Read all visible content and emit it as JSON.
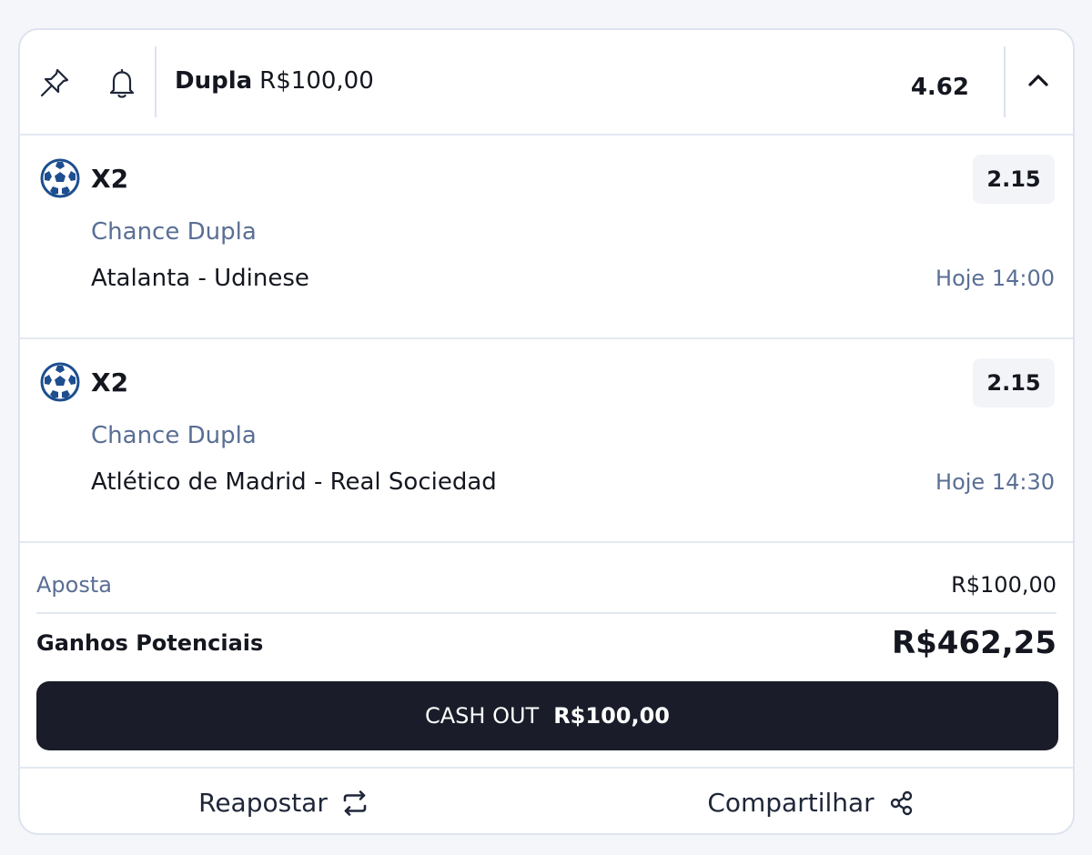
{
  "header": {
    "bet_type": "Dupla",
    "stake": "R$100,00",
    "total_odds": "4.62",
    "pin_icon": "pin-icon",
    "bell_icon": "bell-icon",
    "collapse_icon": "chevron-up-icon"
  },
  "selections": [
    {
      "sport_icon": "soccer-ball-icon",
      "pick": "X2",
      "odds": "2.15",
      "market": "Chance Dupla",
      "event": "Atalanta - Udinese",
      "time": "Hoje 14:00"
    },
    {
      "sport_icon": "soccer-ball-icon",
      "pick": "X2",
      "odds": "2.15",
      "market": "Chance Dupla",
      "event": "Atlético de Madrid - Real Sociedad",
      "time": "Hoje 14:30"
    }
  ],
  "summary": {
    "stake_label": "Aposta",
    "stake_value": "R$100,00",
    "win_label": "Ganhos Potenciais",
    "win_value": "R$462,25"
  },
  "cashout": {
    "label": "CASH OUT",
    "amount": "R$100,00"
  },
  "footer": {
    "rebet_label": "Reapostar",
    "share_label": "Compartilhar",
    "rebet_icon": "repeat-icon",
    "share_icon": "share-icon"
  },
  "colors": {
    "accent_dark": "#1a1d29",
    "muted_blue": "#5a6f95",
    "ball_blue": "#1d4e8f"
  }
}
